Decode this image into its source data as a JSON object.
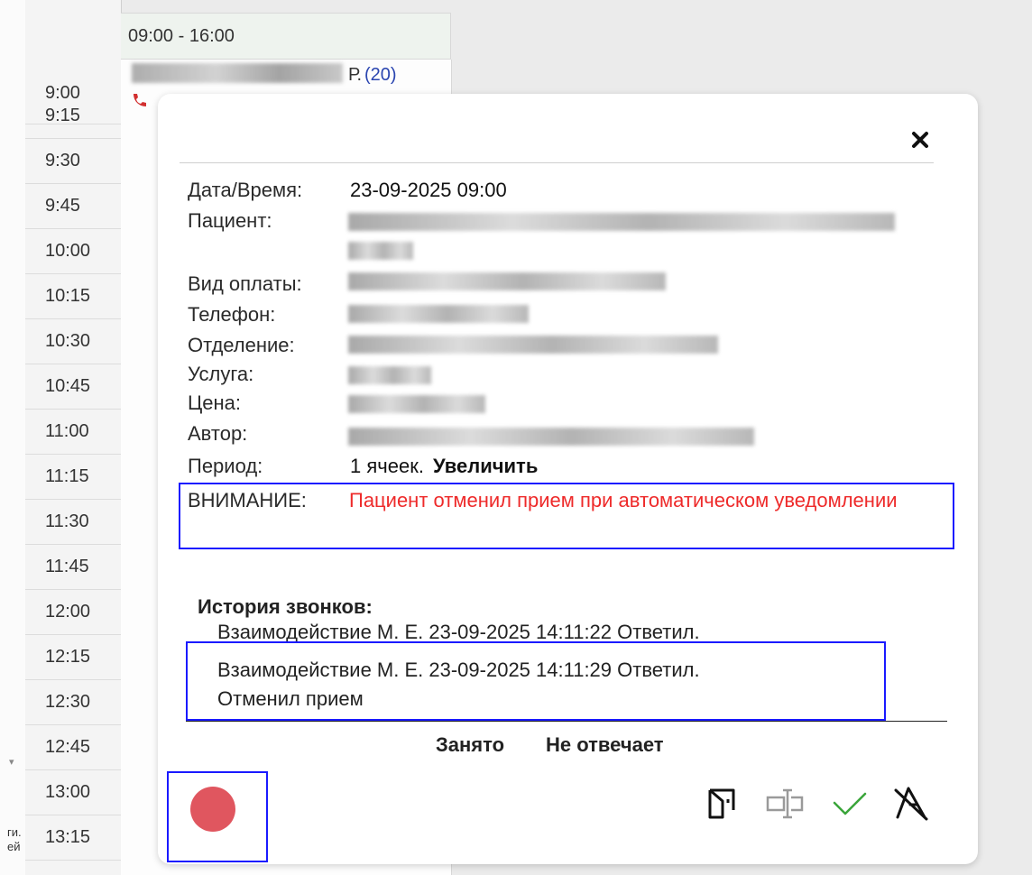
{
  "schedule": {
    "column_header": "09:00 - 16:00",
    "times": [
      "9:00",
      "9:15",
      "9:30",
      "9:45",
      "10:00",
      "10:15",
      "10:30",
      "10:45",
      "11:00",
      "11:15",
      "11:30",
      "11:45",
      "12:00",
      "12:15",
      "12:30",
      "12:45",
      "13:00",
      "13:15"
    ],
    "appointment": {
      "name_suffix": "Р.",
      "count": "(20)"
    },
    "side_labels": [
      "ги.",
      "ей"
    ]
  },
  "modal": {
    "date_time_label": "Дата/Время:",
    "date_time_value": "23-09-2025 09:00",
    "patient_label": "Пациент:",
    "payment_label": "Вид оплаты:",
    "phone_label": "Телефон:",
    "department_label": "Отделение:",
    "service_label": "Услуга:",
    "price_label": "Цена:",
    "author_label": "Автор:",
    "period_label": "Период:",
    "period_value": "1 ячеек.",
    "enlarge_label": "Увеличить",
    "warning_label": "ВНИМАНИЕ:",
    "warning_text": "Пациент отменил прием при автоматическом уведомлении",
    "history_title": "История звонков:",
    "history": [
      "Взаимодействие М. Е. 23-09-2025 14:11:22 Ответил.",
      "Взаимодействие М. Е. 23-09-2025 14:11:29 Ответил.",
      "Отменил прием"
    ],
    "busy_label": "Занято",
    "no_answer_label": "Не отвечает",
    "colors": {
      "warning": "#ee2a2a",
      "highlight_border": "#1a1aff",
      "record": "#e0565f",
      "check": "#3aa53a"
    }
  }
}
